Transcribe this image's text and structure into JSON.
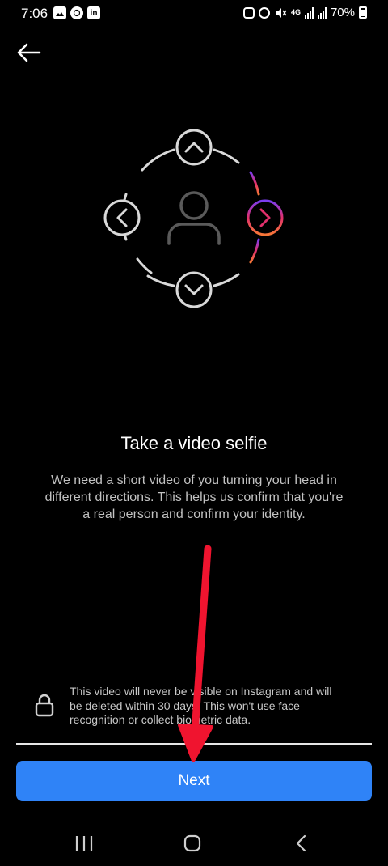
{
  "status_bar": {
    "time": "7:06",
    "left_icons": [
      "gallery-icon",
      "whatsapp-icon",
      "linkedin-icon"
    ],
    "right_icons": [
      "android-icon",
      "alarm-icon",
      "mute-icon",
      "4g-icon",
      "signal-icon",
      "signal-icon"
    ],
    "network": "4G",
    "battery": "70%"
  },
  "header": {
    "back_icon": "arrow-left-icon"
  },
  "illustration": {
    "icons": [
      "chevron-up-icon",
      "chevron-down-icon",
      "chevron-left-icon",
      "chevron-right-icon",
      "person-icon"
    ],
    "accent_gradient": [
      "#7a3cf0",
      "#e1306c",
      "#f77737"
    ],
    "line_color": "#d9d9d9"
  },
  "content": {
    "title": "Take a video selfie",
    "description": "We need a short video of you turning your head in different directions. This helps us confirm that you're a real person and confirm your identity."
  },
  "privacy": {
    "icon": "lock-icon",
    "note": "This video will never be visible on Instagram and will be deleted within 30 days. This won't use face recognition or collect biometric data."
  },
  "actions": {
    "next_label": "Next",
    "button_color": "#2f83f7"
  },
  "annotation": {
    "color": "#f0142f"
  },
  "nav_bar": {
    "icons": [
      "recent-apps-icon",
      "home-icon",
      "back-nav-icon"
    ]
  }
}
